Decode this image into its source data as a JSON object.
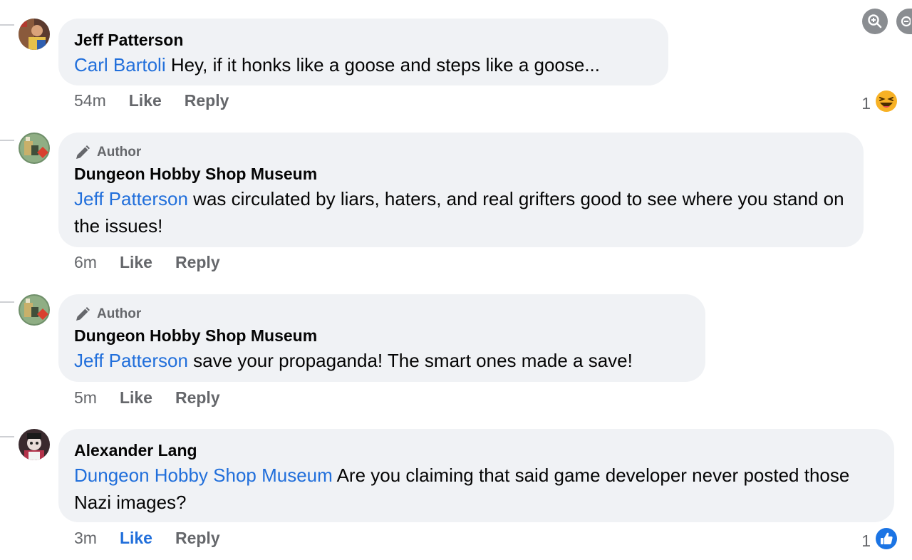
{
  "comments": [
    {
      "name": "Jeff Patterson",
      "mention": "Carl Bartoli",
      "text": " Hey, if it honks like a goose and steps like a goose...",
      "time": "54m",
      "like_label": "Like",
      "reply_label": "Reply",
      "reaction_count": "1",
      "reaction_icon": "haha-emoji-icon"
    },
    {
      "badge": "Author",
      "name": "Dungeon Hobby Shop Museum",
      "mention": "Jeff Patterson",
      "text": " was circulated by liars, haters, and real grifters good to see where you stand on the issues!",
      "time": "6m",
      "like_label": "Like",
      "reply_label": "Reply"
    },
    {
      "badge": "Author",
      "name": "Dungeon Hobby Shop Museum",
      "mention": "Jeff Patterson",
      "text": " save your propaganda! The smart ones made a save!",
      "time": "5m",
      "like_label": "Like",
      "reply_label": "Reply"
    },
    {
      "name": "Alexander Lang",
      "mention": "Dungeon Hobby Shop Museum",
      "text": " Are you claiming that said game developer never posted those Nazi images?",
      "time": "3m",
      "like_label": "Like",
      "reply_label": "Reply",
      "reaction_count": "1",
      "reaction_icon": "like-thumb-icon"
    }
  ],
  "colors": {
    "mention": "#216fdb",
    "bubble": "#f0f2f5",
    "meta": "#65676b",
    "liked": "#216fdb"
  }
}
